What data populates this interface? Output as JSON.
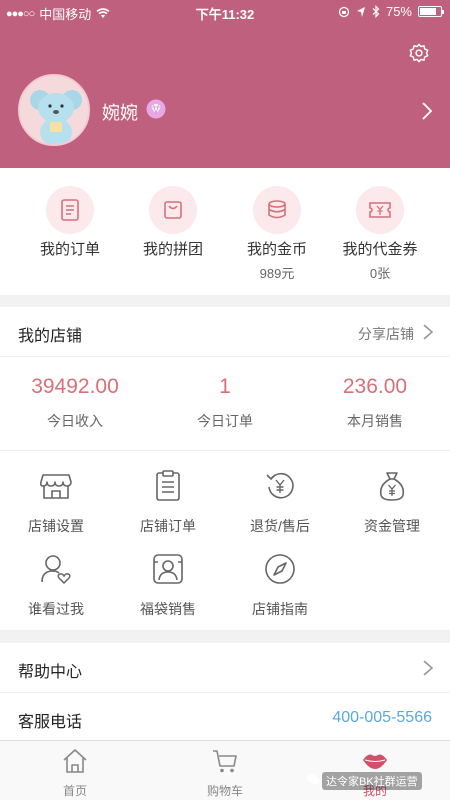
{
  "status_bar": {
    "carrier": "中国移动",
    "time": "下午11:32",
    "battery": "75%"
  },
  "colors": {
    "header": "#c0607f",
    "accent": "#d8707a",
    "link": "#5aa9d6",
    "icon_bg": "#fbe9ec"
  },
  "profile": {
    "name": "婉婉"
  },
  "quick": [
    {
      "label": "我的订单",
      "sub": ""
    },
    {
      "label": "我的拼团",
      "sub": ""
    },
    {
      "label": "我的金币",
      "sub": "989元"
    },
    {
      "label": "我的代金券",
      "sub": "0张"
    }
  ],
  "shop": {
    "title": "我的店铺",
    "share": "分享店铺",
    "stats": [
      {
        "value": "39492.00",
        "label": "今日收入"
      },
      {
        "value": "1",
        "label": "今日订单"
      },
      {
        "value": "236.00",
        "label": "本月销售"
      }
    ],
    "tools": [
      {
        "label": "店铺设置",
        "icon": "store-icon"
      },
      {
        "label": "店铺订单",
        "icon": "clipboard-icon"
      },
      {
        "label": "退货/售后",
        "icon": "refund-icon"
      },
      {
        "label": "资金管理",
        "icon": "money-bag-icon"
      },
      {
        "label": "谁看过我",
        "icon": "visitor-icon"
      },
      {
        "label": "福袋销售",
        "icon": "lucky-bag-icon"
      },
      {
        "label": "店铺指南",
        "icon": "compass-icon"
      }
    ]
  },
  "help": {
    "title": "帮助中心"
  },
  "service": {
    "title": "客服电话",
    "phone": "400-005-5566"
  },
  "tabs": [
    {
      "label": "首页",
      "icon": "home-icon"
    },
    {
      "label": "购物车",
      "icon": "cart-icon"
    },
    {
      "label": "我的",
      "icon": "lips-icon"
    }
  ],
  "watermark": "达令家BK社群运营"
}
